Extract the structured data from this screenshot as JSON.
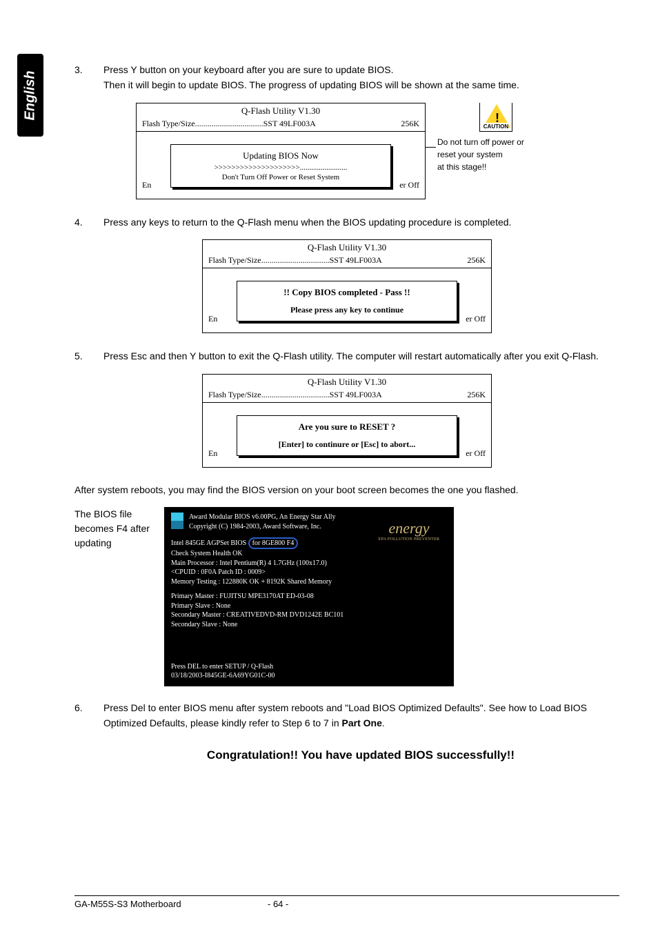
{
  "side_tab": "English",
  "steps": {
    "s3": {
      "num": "3.",
      "line1": "Press Y button on your keyboard after you are sure to update BIOS.",
      "line2": "Then it will begin to update BIOS. The progress of updating BIOS will be shown at the same time."
    },
    "s4": {
      "num": "4.",
      "text": "Press any keys to return to the Q-Flash menu when the BIOS updating procedure is completed."
    },
    "s5": {
      "num": "5.",
      "text": "Press Esc and then Y button to exit the Q-Flash utility. The computer will restart automatically after you exit Q-Flash."
    },
    "s6": {
      "num": "6.",
      "text": "Press Del to enter BIOS menu after system reboots and \"Load BIOS Optimized Defaults\". See how to Load BIOS Optimized Defaults, please kindly refer to Step 6 to 7 in ",
      "bold": "Part One",
      "tail": "."
    }
  },
  "qflash": {
    "title": "Q-Flash Utility V1.30",
    "flash_label": "Flash Type/Size.................................SST 49LF003A",
    "size": "256K",
    "footer_left_en": "En",
    "footer_right": "er Off",
    "panel1": {
      "msg": "Updating BIOS Now",
      "progress": ">>>>>>>>>>>>>>>>>>>>.........................",
      "footer_text": "Don't Turn Off Power or Reset System"
    },
    "panel2": {
      "msg1": "!! Copy BIOS completed - Pass !!",
      "msg2": "Please press any key to continue"
    },
    "panel3": {
      "msg1": "Are you sure to RESET ?",
      "msg2": "[Enter] to continure or [Esc] to abort..."
    }
  },
  "caution": {
    "label": "CAUTION",
    "mark": "!",
    "text1": "Do not turn off power or",
    "text2": "reset your system",
    "text3": "at this stage!!"
  },
  "after_reboot": "After system reboots, you may find the BIOS version on your boot screen becomes the one you flashed.",
  "boot_label": "The BIOS file becomes F4 after updating",
  "boot": {
    "head1": "Award Modular BIOS v6.00PG, An Energy Star Ally",
    "head2": "Copyright (C) 1984-2003, Award Software, Inc.",
    "agp1": "Intel 845GE AGPSet BIOS ",
    "agp_highlight": "for 8GE800 F4",
    "health": "Check System Health OK",
    "proc": "Main Processor : Intel Pentium(R) 4  1.7GHz (100x17.0)",
    "cpuid": "<CPUID : 0F0A Patch ID  : 0009>",
    "mem": "Memory Testing  :  122880K OK + 8192K Shared Memory",
    "pm": "Primary Master : FUJITSU MPE3170AT ED-03-08",
    "ps": "Primary Slave : None",
    "sm": "Secondary Master : CREATIVEDVD-RM DVD1242E BC101",
    "ss": "Secondary Slave : None",
    "del": "Press DEL to enter SETUP / Q-Flash",
    "code": "03/18/2003-I845GE-6A69YG01C-00",
    "energy": "energy",
    "energy_sub": "EPA  POLLUTION PREVENTER"
  },
  "congrats": "Congratulation!! You have updated BIOS successfully!!",
  "footer": {
    "mb": "GA-M55S-S3 Motherboard",
    "page": "- 64 -"
  }
}
